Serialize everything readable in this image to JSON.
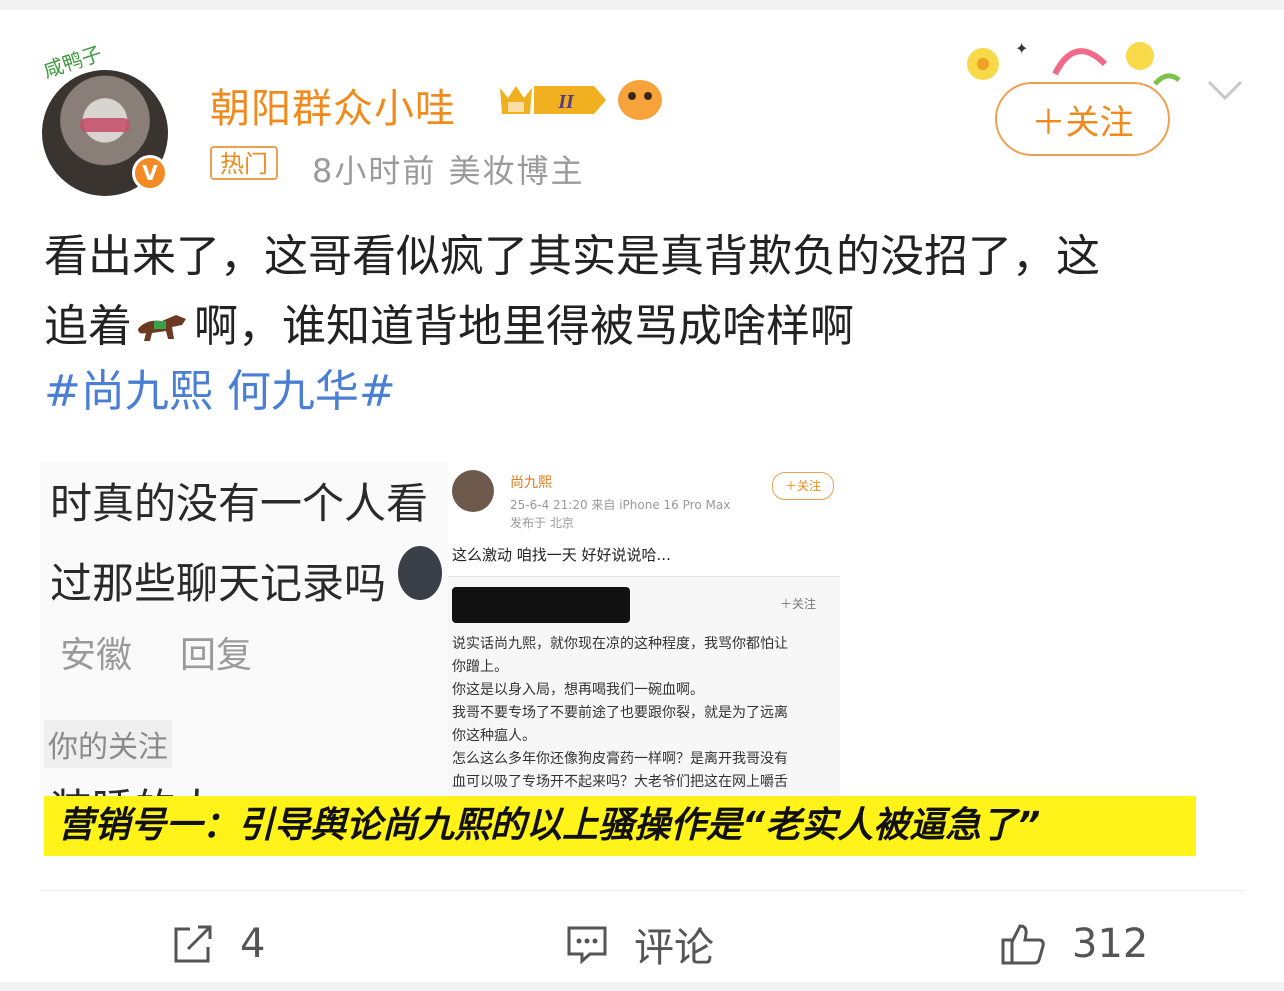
{
  "post": {
    "avatar_tag": "咸鸭子",
    "username": "朝阳群众小哇",
    "level_badge": "II",
    "hot_label": "热门",
    "meta": "8小时前  美妆博主",
    "follow_label": "＋关注",
    "text_line1": "看出来了，这哥看似疯了其实是真背欺负的没招了，这",
    "text_line2a": "追着",
    "text_line2b": "啊，谁知道背地里得被骂成啥样啊",
    "hashtags": "#尚九熙 何九华#"
  },
  "embed": {
    "left": {
      "line1": "时真的没有一个人看",
      "line2": "过那些聊天记录吗",
      "meta_location": "安徽",
      "meta_reply": "回复",
      "following_label": "你的关注",
      "partial_line": "装睡的人"
    },
    "right": {
      "name": "尚九熙",
      "time_device": "25-6-4 21:20  来自 iPhone 16 Pro Max",
      "location": "发布于 北京",
      "follow_label": "＋关注",
      "post_text": "这么激动 咱找一天 好好说说哈...",
      "inner_follow": "＋关注",
      "paragraph": [
        "说实话尚九熙，就你现在凉的这种程度，我骂你都怕让",
        "你蹭上。",
        "你这是以身入局，想再喝我们一碗血啊。",
        "我哥不要专场了不要前途了也要跟你裂，就是为了远离",
        "你这种瘟人。",
        "怎么这么多年你还像狗皮膏药一样啊？是离开我哥没有",
        "血可以吸了专场开不起来吗？大老爷们把这在网上嚼舌"
      ]
    }
  },
  "caption": "营销号一：引导舆论尚九熙的以上骚操作是“老实人被逼急了”",
  "actions": {
    "repost_count": "4",
    "comment_label": "评论",
    "like_count": "312"
  },
  "colors": {
    "accent_orange": "#f08a1d",
    "hashtag_blue": "#4a7fd4",
    "caption_yellow": "#fff31a"
  }
}
